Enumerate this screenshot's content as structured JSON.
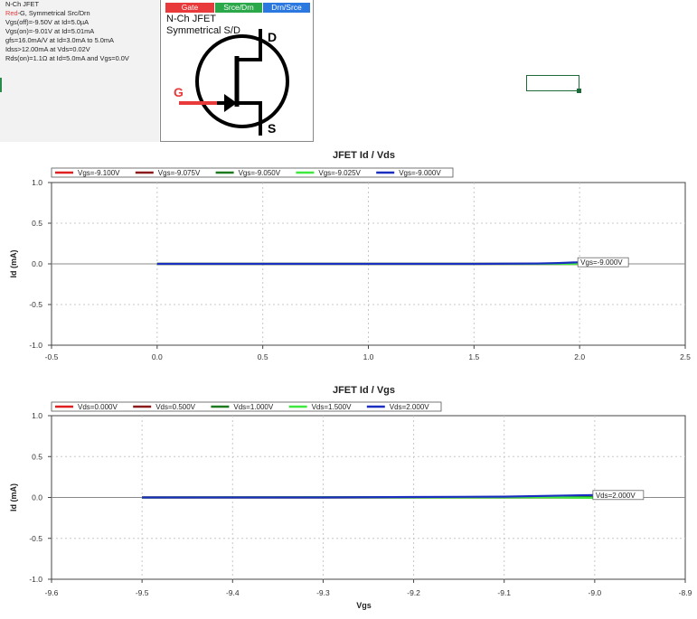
{
  "specs": {
    "title": "N-Ch JFET",
    "red_word": "Red",
    "line2_rest": "-G, Symmetrical Src/Drn",
    "lines": [
      "Vgs(off)=-9.50V at Id=5.0µA",
      "Vgs(on)=-9.01V at Id=5.01mA",
      "gfs=16.0mA/V at Id=3.0mA to 5.0mA",
      "Idss>12.00mA at Vds=0.02V",
      "Rds(on)=1.1Ω at Id=5.0mA and Vgs=0.0V"
    ]
  },
  "symbol": {
    "pins": [
      {
        "label": "Gate",
        "color": "#e83a3a"
      },
      {
        "label": "Srce/Drn",
        "color": "#2aa84a"
      },
      {
        "label": "Drn/Srce",
        "color": "#2a78e0"
      }
    ],
    "line1": "N-Ch JFET",
    "line2": "Symmetrical S/D",
    "gate_label": "G",
    "drain_label": "D",
    "source_label": "S",
    "gate_color": "#e83a3a"
  },
  "chart_data": [
    {
      "type": "line",
      "title": "JFET Id / Vds",
      "xlabel": "",
      "ylabel": "Id (mA)",
      "xlim": [
        -0.5,
        2.5
      ],
      "ylim": [
        -1.0,
        1.0
      ],
      "xticks": [
        -0.5,
        0.0,
        0.5,
        1.0,
        1.5,
        2.0,
        2.5
      ],
      "xtick_labels": [
        "-0.5",
        "0.0",
        "0.5",
        "1.0",
        "1.5",
        "2.0",
        "2.5"
      ],
      "yticks": [
        1.0,
        0.5,
        0.0,
        -0.5,
        -1.0
      ],
      "ytick_labels": [
        "1.0",
        "0.5",
        "0.0",
        "-0.5",
        "-1.0"
      ],
      "grid": true,
      "legend_position": "top-left",
      "series": [
        {
          "name": "Vgs=-9.100V",
          "color": "#e02020",
          "x": [
            0.0,
            2.0
          ],
          "y": [
            0.0,
            0.0
          ]
        },
        {
          "name": "Vgs=-9.075V",
          "color": "#8b1a1a",
          "x": [
            0.0,
            2.0
          ],
          "y": [
            0.0,
            0.0
          ]
        },
        {
          "name": "Vgs=-9.050V",
          "color": "#1e7a1e",
          "x": [
            0.0,
            2.0
          ],
          "y": [
            0.0,
            0.0
          ]
        },
        {
          "name": "Vgs=-9.025V",
          "color": "#3ee83e",
          "x": [
            0.0,
            2.0
          ],
          "y": [
            0.0,
            0.0
          ]
        },
        {
          "name": "Vgs=-9.000V",
          "color": "#1a2fbf",
          "x": [
            0.0,
            0.5,
            1.0,
            1.5,
            1.8,
            1.9,
            2.0
          ],
          "y": [
            0.0,
            0.0,
            0.0,
            0.0,
            0.005,
            0.01,
            0.02
          ]
        }
      ],
      "annotation": {
        "text": "Vgs=-9.000V",
        "x": 2.0,
        "y": 0.02
      }
    },
    {
      "type": "line",
      "title": "JFET Id / Vgs",
      "xlabel": "Vgs",
      "ylabel": "Id (mA)",
      "xlim": [
        -9.6,
        -8.9
      ],
      "ylim": [
        -1.0,
        1.0
      ],
      "xticks": [
        -9.6,
        -9.5,
        -9.4,
        -9.3,
        -9.2,
        -9.1,
        -9.0,
        -8.9
      ],
      "xtick_labels": [
        "-9.6",
        "-9.5",
        "-9.4",
        "-9.3",
        "-9.2",
        "-9.1",
        "-9.0",
        "-8.9"
      ],
      "yticks": [
        1.0,
        0.5,
        0.0,
        -0.5,
        -1.0
      ],
      "ytick_labels": [
        "1.0",
        "0.5",
        "0.0",
        "-0.5",
        "-1.0"
      ],
      "grid": true,
      "legend_position": "top-left",
      "series": [
        {
          "name": "Vds=0.000V",
          "color": "#e02020",
          "x": [
            -9.5,
            -9.0
          ],
          "y": [
            0.0,
            0.0
          ]
        },
        {
          "name": "Vds=0.500V",
          "color": "#8b1a1a",
          "x": [
            -9.5,
            -9.0
          ],
          "y": [
            0.0,
            0.0
          ]
        },
        {
          "name": "Vds=1.000V",
          "color": "#1e7a1e",
          "x": [
            -9.5,
            -9.0
          ],
          "y": [
            0.0,
            0.005
          ]
        },
        {
          "name": "Vds=1.500V",
          "color": "#3ee83e",
          "x": [
            -9.5,
            -9.1,
            -9.05,
            -9.0
          ],
          "y": [
            0.0,
            0.0,
            0.0,
            -0.005
          ]
        },
        {
          "name": "Vds=2.000V",
          "color": "#1a2fbf",
          "x": [
            -9.5,
            -9.3,
            -9.2,
            -9.1,
            -9.05,
            -9.0
          ],
          "y": [
            0.0,
            0.0,
            0.005,
            0.01,
            0.02,
            0.03
          ]
        }
      ],
      "annotation": {
        "text": "Vds=2.000V",
        "x": -9.0,
        "y": 0.03
      }
    }
  ]
}
